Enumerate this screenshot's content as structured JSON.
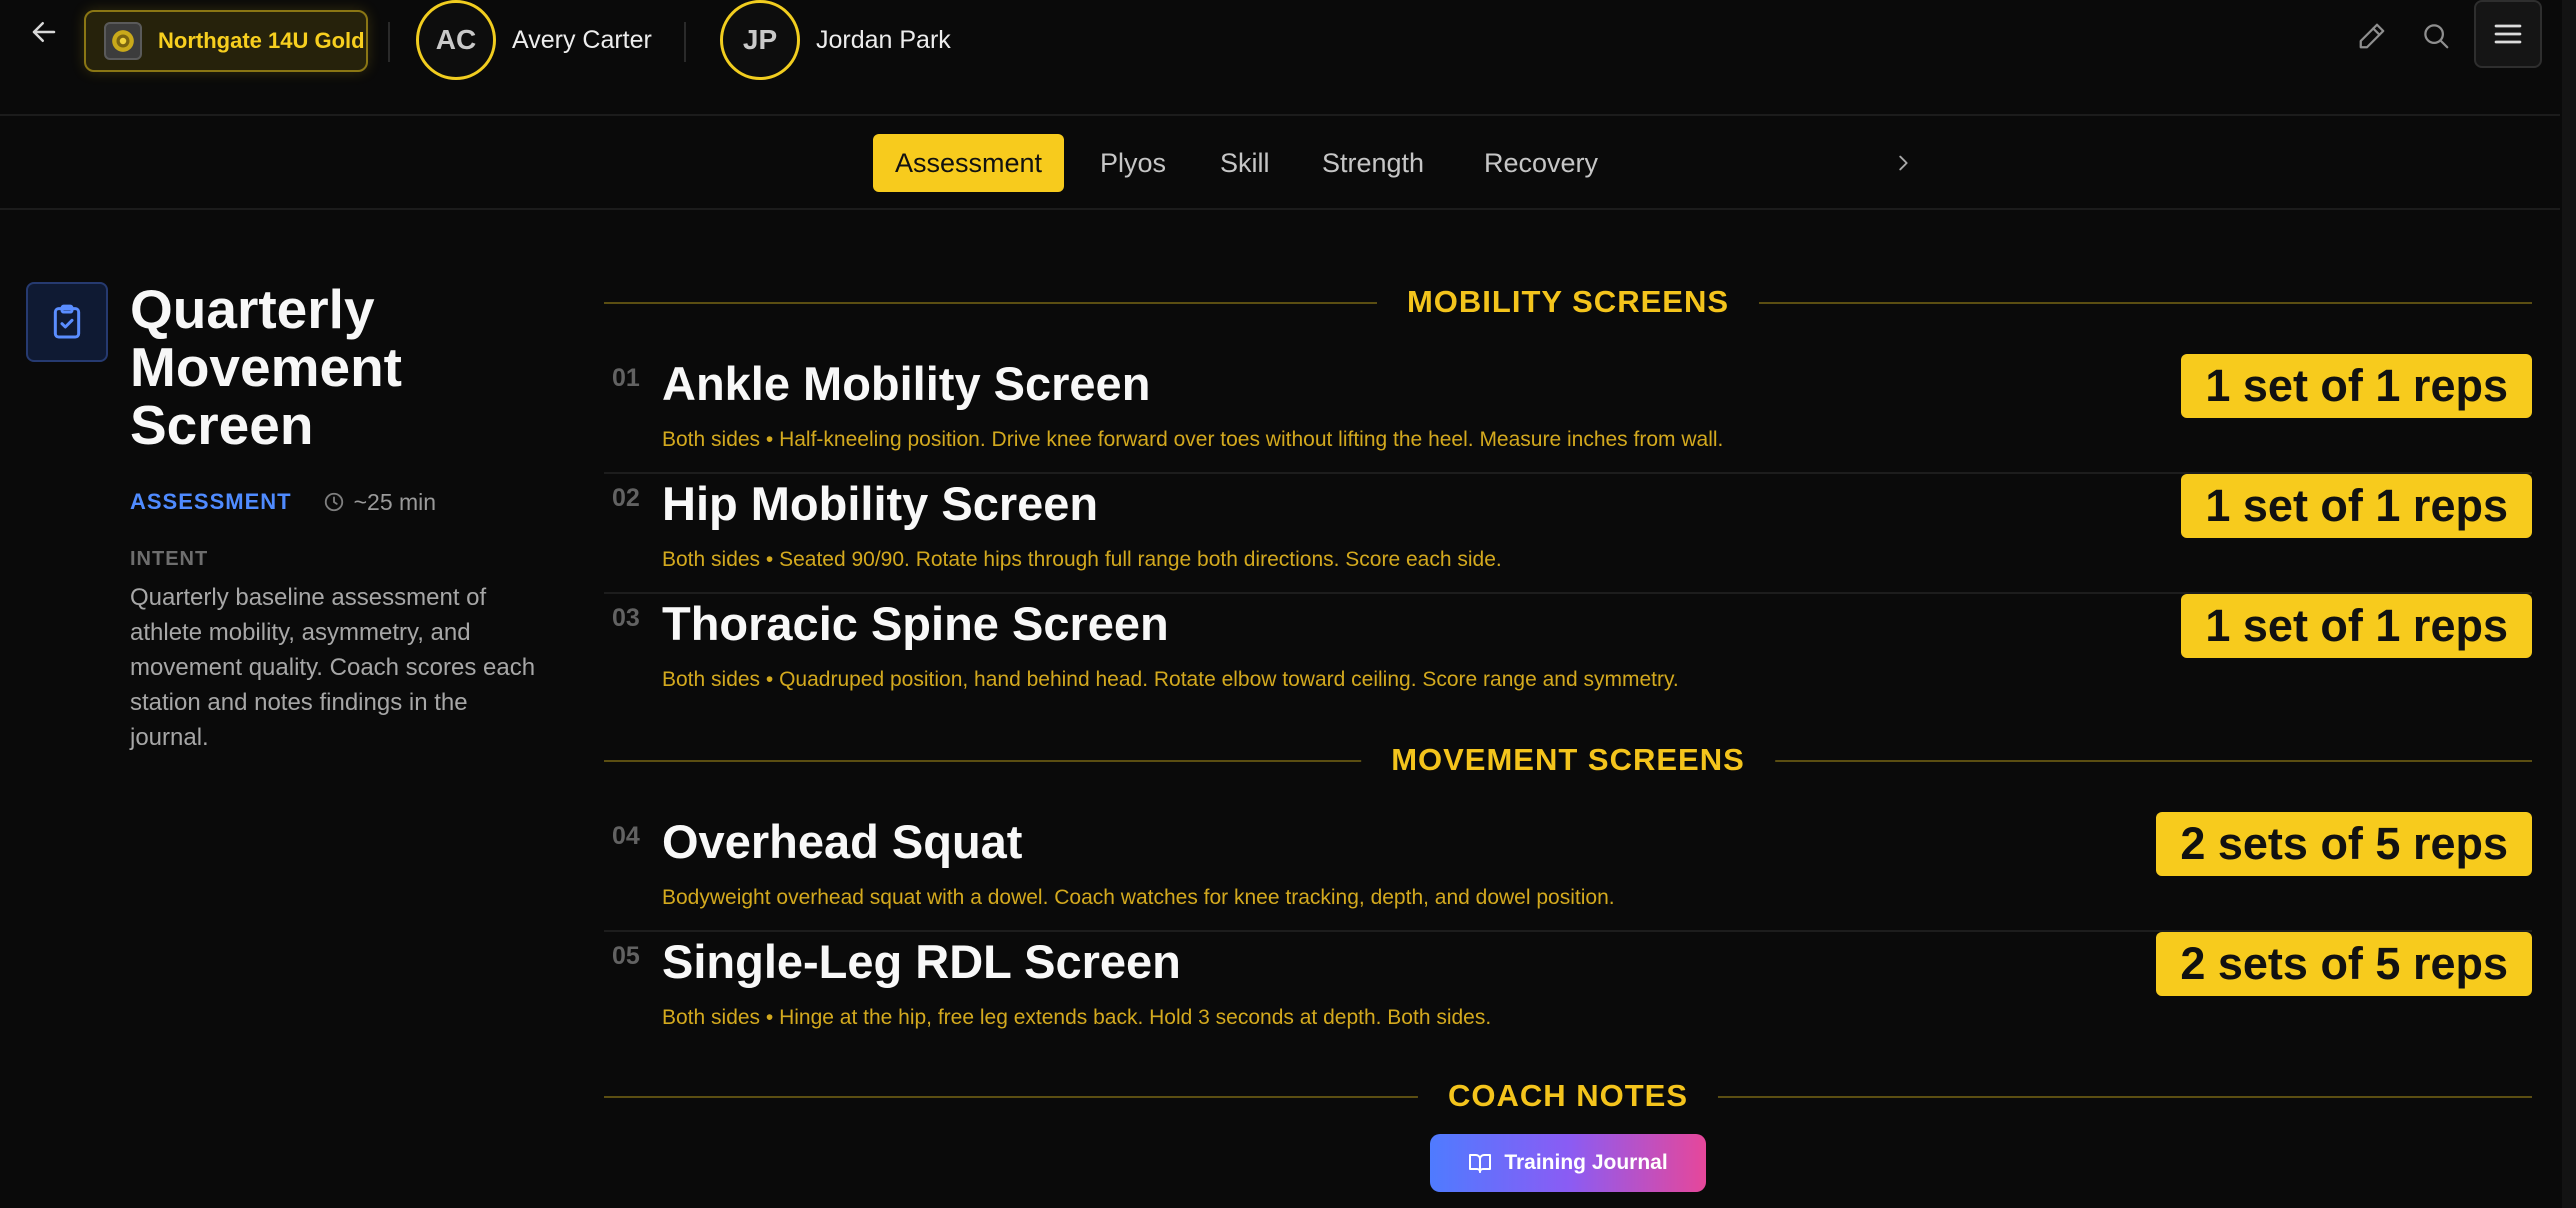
{
  "header": {
    "team": "Northgate 14U Gold",
    "athletes": [
      {
        "initials": "AC",
        "name": "Avery Carter"
      },
      {
        "initials": "JP",
        "name": "Jordan Park"
      }
    ]
  },
  "tabs": [
    "Assessment",
    "Plyos",
    "Skill",
    "Strength",
    "Recovery"
  ],
  "active_tab": "Assessment",
  "workout": {
    "title": "Quarterly Movement Screen",
    "type": "ASSESSMENT",
    "duration": "~25 min",
    "intent_label": "INTENT",
    "intent": "Quarterly baseline assessment of athlete mobility, asymmetry, and movement quality. Coach scores each station and notes findings in the journal."
  },
  "sections": [
    {
      "title": "MOBILITY SCREENS",
      "exercises": [
        {
          "num": "01",
          "name": "Ankle Mobility Screen",
          "desc": "Both sides • Half-kneeling position. Drive knee forward over toes without lifting the heel. Measure inches from wall.",
          "dose": "1 set of 1 reps"
        },
        {
          "num": "02",
          "name": "Hip Mobility Screen",
          "desc": "Both sides • Seated 90/90. Rotate hips through full range both directions. Score each side.",
          "dose": "1 set of 1 reps"
        },
        {
          "num": "03",
          "name": "Thoracic Spine Screen",
          "desc": "Both sides • Quadruped position, hand behind head. Rotate elbow toward ceiling. Score range and symmetry.",
          "dose": "1 set of 1 reps"
        }
      ]
    },
    {
      "title": "MOVEMENT SCREENS",
      "exercises": [
        {
          "num": "04",
          "name": "Overhead Squat",
          "desc": "Bodyweight overhead squat with a dowel. Coach watches for knee tracking, depth, and dowel position.",
          "dose": "2 sets of 5 reps"
        },
        {
          "num": "05",
          "name": "Single-Leg RDL Screen",
          "desc": "Both sides • Hinge at the hip, free leg extends back. Hold 3 seconds at depth. Both sides.",
          "dose": "2 sets of 5 reps"
        }
      ]
    },
    {
      "title": "COACH NOTES",
      "exercises": []
    }
  ],
  "journal_button": "Training Journal",
  "icons": {
    "back": "arrow-left-icon",
    "edit": "pencil-icon",
    "search": "search-icon",
    "menu": "hamburger-menu-icon",
    "next": "chevron-right-icon",
    "workout": "clipboard-check-icon",
    "clock": "clock-icon",
    "journal": "book-open-icon"
  },
  "colors": {
    "accent": "#f7cb1d",
    "background": "#0a0a0a",
    "type_label": "#4f8bff",
    "description": "#d3a91e"
  }
}
